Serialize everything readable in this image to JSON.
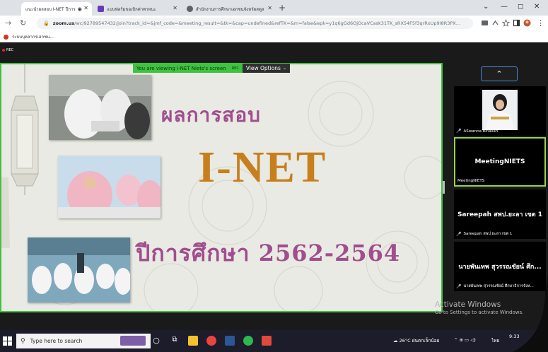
{
  "browser": {
    "tabs": [
      {
        "label": "แนะนำผลสอบ I-NET ปีการ",
        "active": true,
        "color": "#e53935"
      },
      {
        "label": "แบบฟอร์มขอเบิกค่าพาหนะ",
        "active": false,
        "color": "#673ab7"
      },
      {
        "label": "สำนักงานการศึกษาเอกชนจังหวัดสตูล",
        "active": false,
        "color": "#555555"
      }
    ],
    "url_host": "zoom.us",
    "url_rest": "/wc/92789547432/join?track_id=&jmf_code=&meeting_result=&tk=&cap=undefined&refTK=&m=false&epk=y1q6gGd6OjOcaVCask31TK_sRX54F5f3qrRxUp9I8R3PX...",
    "bookmark": "ระบบบุคลากรเอกชน..."
  },
  "zoom": {
    "rec_label": "REC",
    "viewing_label": "You are viewing I-NET Niets's screen",
    "viewing_rec": "REC",
    "view_options": "View Options",
    "slide": {
      "line1": "ผลการสอบ",
      "line2": "I-NET",
      "line3": "ปีการศึกษา  2562-2564"
    },
    "participants": [
      {
        "name": "ASwanna binasan",
        "type": "video"
      },
      {
        "name": "MeetingNIETS",
        "center": "MeetingNIETS",
        "active": true
      },
      {
        "name": "Sareepah สพป.ยะลา เขต 1",
        "center": "Sareepah สพป.ยะลา เขต 1"
      },
      {
        "name": "นายพันเทพ สุวรรณชัยน์ ศึกษาธิการจังห...",
        "center": "นายพันเทพ สุวรรณชัยน์ ศึก..."
      }
    ],
    "activate_title": "Activate Windows",
    "activate_sub": "Go to Settings to activate Windows."
  },
  "taskbar": {
    "search_placeholder": "Type here to search",
    "weather": "26°C  ฝนตกเล็กน้อย",
    "lang": "ไทย",
    "time": "9:33"
  }
}
